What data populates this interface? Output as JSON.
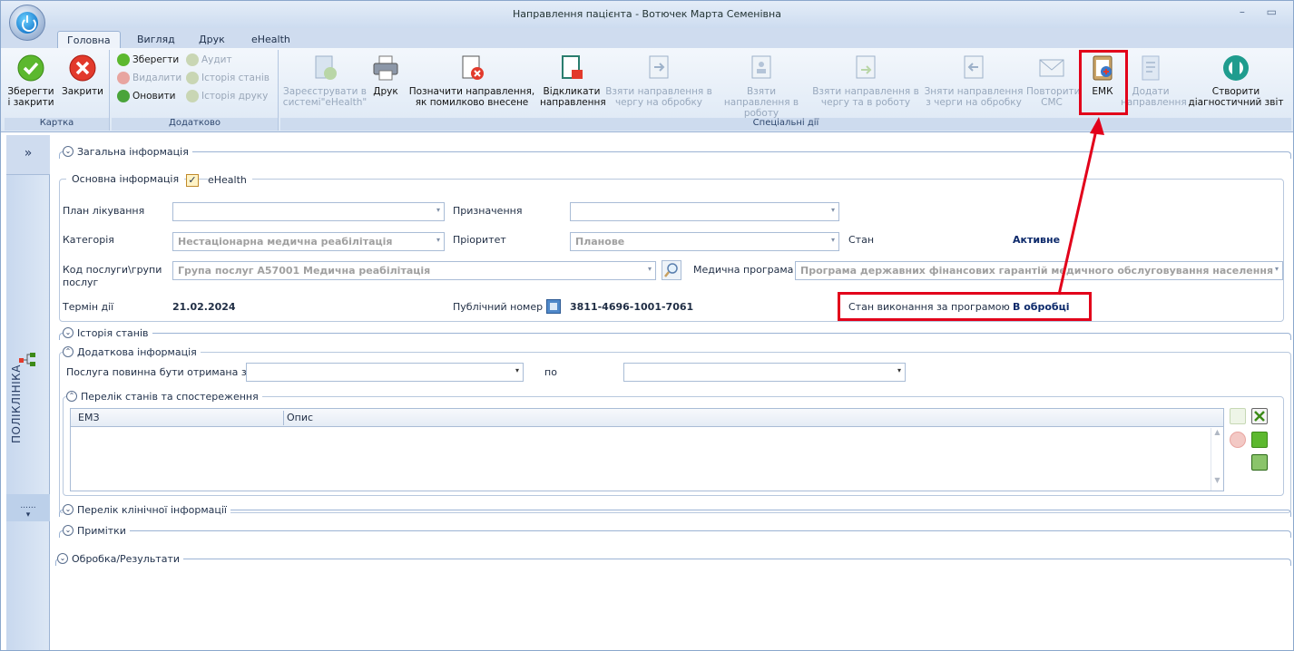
{
  "window": {
    "title": "Направлення пацієнта - Вотючек Марта Семенівна",
    "controls": "– ▭"
  },
  "tabs": [
    "Головна",
    "Вигляд",
    "Друк",
    "eHealth"
  ],
  "ribbon": {
    "group_card": {
      "label": "Картка",
      "save_close": "Зберегти і закрити",
      "close": "Закрити"
    },
    "group_extra": {
      "label": "Додатково",
      "save": "Зберегти",
      "audit": "Аудит",
      "delete": "Видалити",
      "history_states": "Історія станів",
      "refresh": "Оновити",
      "history_print": "Історія друку"
    },
    "group_special": {
      "label": "Спеціальні дії",
      "register": "Зареєструвати в системі\"eHealth\"",
      "print": "Друк",
      "mark_error": "Позначити направлення, як помилково внесене",
      "revoke": "Відкликати направлення",
      "take_queue": "Взяти направлення в чергу на обробку",
      "take_work": "Взяти направлення в роботу",
      "take_queue_work": "Взяти направлення в чергу та в роботу",
      "remove_queue": "Зняти направлення з черги на обробку",
      "repeat_sms": "Повторити СМС",
      "emk": "ЕМК",
      "add_referral": "Додати направлення",
      "create_report": "Створити діагностичний звіт"
    }
  },
  "left_panel": {
    "expand": "»",
    "label": "ПОЛІКЛІНІКА",
    "dots": "......",
    "arrow": "▾"
  },
  "sections": {
    "general": "Загальна інформація",
    "history": "Історія станів",
    "additional": "Додаткова інформація",
    "states_list": "Перелік станів та спостереження",
    "clinical": "Перелік клінічної інформації",
    "notes": "Примітки",
    "processing": "Обробка/Результати"
  },
  "basic_info": {
    "title": "Основна інформація",
    "ehealth_check": "✓",
    "ehealth_label": "eHealth",
    "plan_label": "План лікування",
    "plan_value": "",
    "purpose_label": "Призначення",
    "purpose_value": "",
    "category_label": "Категорія",
    "category_value": "Нестаціонарна медична реабілітація",
    "priority_label": "Пріоритет",
    "priority_value": "Планове",
    "status_label": "Стан",
    "status_value": "Активне",
    "service_label": "Код послуги\\групи послуг",
    "service_value": "Група послуг А57001 Медична реабілітація",
    "program_label": "Медична програма",
    "program_value": "Програма державних фінансових гарантій медичного обслуговування населення",
    "term_label": "Термін дії",
    "term_value": "21.02.2024",
    "public_number_label": "Публічний номер",
    "public_number_value": "3811-4696-1001-7061",
    "program_status_label": "Стан виконання за програмою",
    "program_status_value": "В обробці"
  },
  "additional_info": {
    "service_from_label": "Послуга повинна бути отримана з",
    "to_label": "по"
  },
  "grid": {
    "columns": [
      "ЕМЗ",
      "Опис"
    ]
  },
  "colors": {
    "highlight": "#e2001a",
    "accent": "#2a3f66"
  }
}
